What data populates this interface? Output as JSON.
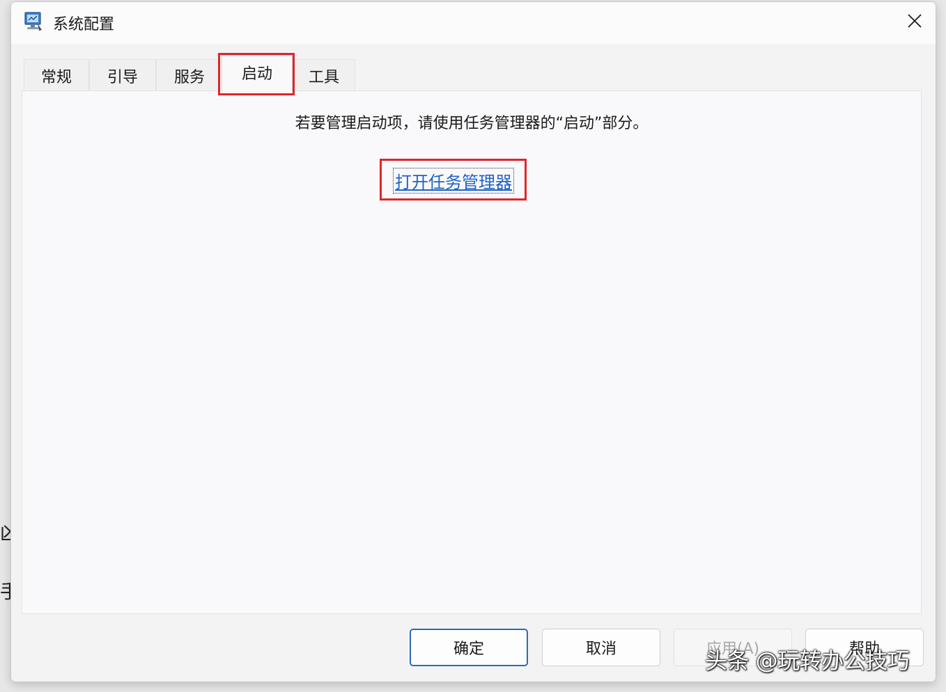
{
  "window": {
    "title": "系统配置",
    "close_label": "✕"
  },
  "tabs": [
    {
      "label": "常规"
    },
    {
      "label": "引导"
    },
    {
      "label": "服务"
    },
    {
      "label": "启动"
    },
    {
      "label": "工具"
    }
  ],
  "active_tab": "启动",
  "startup": {
    "message": "若要管理启动项，请使用任务管理器的“启动”部分。",
    "open_task_manager_link": "打开任务管理器"
  },
  "buttons": {
    "ok": "确定",
    "cancel": "取消",
    "apply": "应用(A)",
    "help": "帮助"
  },
  "background_fragments": [
    "凶",
    "手"
  ],
  "watermark": "头条 @玩转办公技巧",
  "colors": {
    "highlight": "#e0252a",
    "link": "#1f62c4",
    "primary_border": "#2b6bb5"
  }
}
